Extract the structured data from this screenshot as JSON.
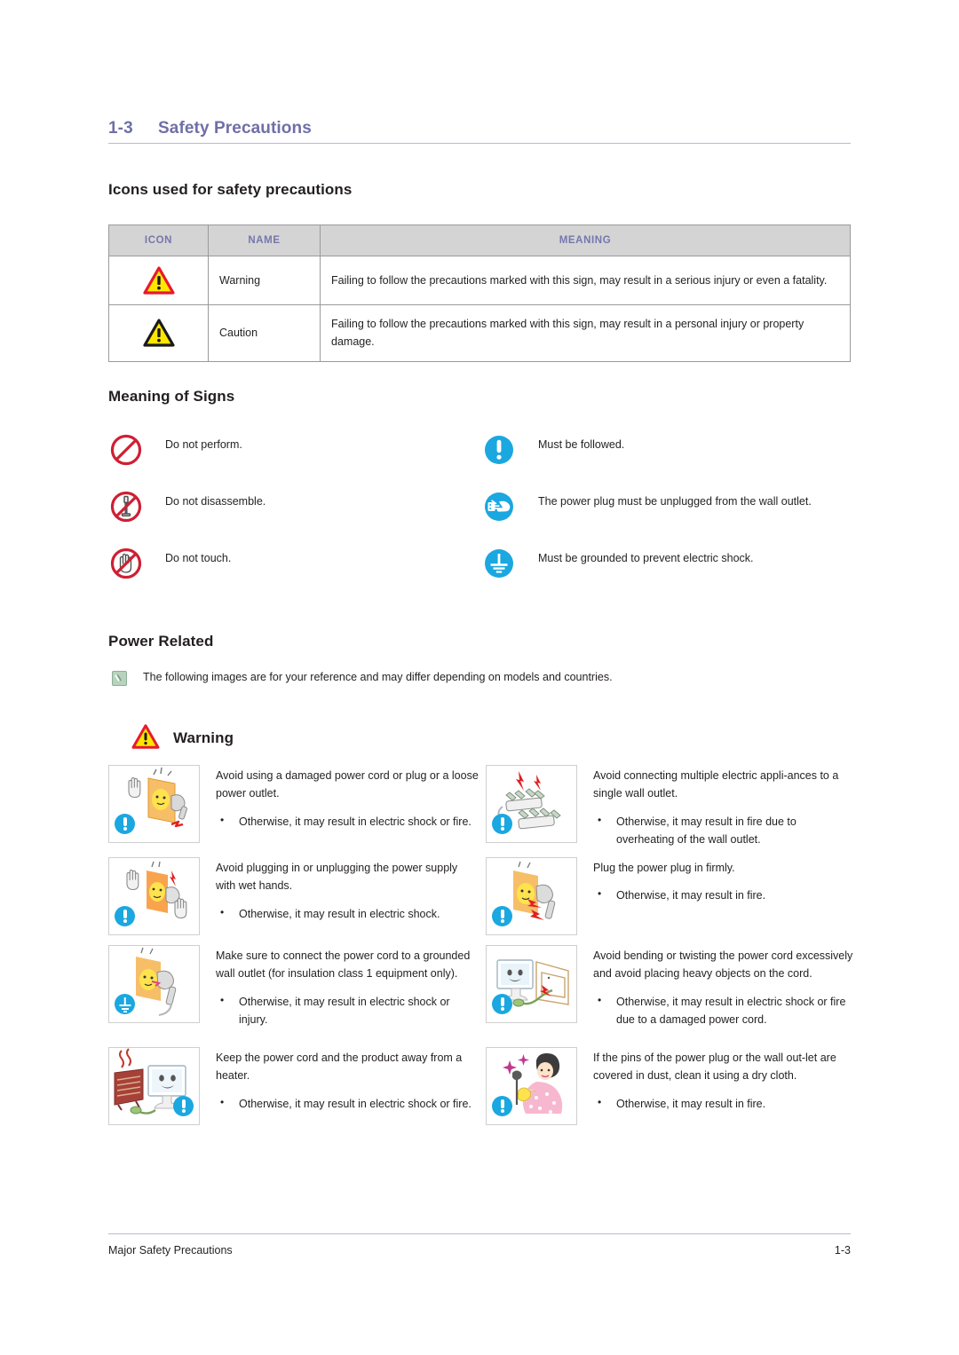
{
  "section": {
    "number": "1-3",
    "title": "Safety Precautions"
  },
  "headings": {
    "icons_used": "Icons used for safety precautions",
    "meaning_of_signs": "Meaning of Signs",
    "power_related": "Power Related"
  },
  "icons_table": {
    "headers": [
      "ICON",
      "NAME",
      "MEANING"
    ],
    "rows": [
      {
        "icon": "warning-triangle-red-icon",
        "name": "Warning",
        "meaning": "Failing to follow the precautions marked with this sign, may result in a serious injury or even a fatality."
      },
      {
        "icon": "caution-triangle-black-icon",
        "name": "Caution",
        "meaning": "Failing to follow the precautions marked with this sign, may result in a personal injury or property damage."
      }
    ]
  },
  "signs": {
    "left": [
      {
        "icon": "prohibition-circle-icon",
        "label": "Do not perform."
      },
      {
        "icon": "no-disassemble-icon",
        "label": "Do not disassemble."
      },
      {
        "icon": "no-touch-hand-icon",
        "label": "Do not touch."
      }
    ],
    "right": [
      {
        "icon": "mandatory-exclamation-icon",
        "label": "Must be followed."
      },
      {
        "icon": "unplug-power-icon",
        "label": "The power plug must be unplugged from the wall outlet."
      },
      {
        "icon": "ground-earth-icon",
        "label": "Must be grounded to prevent electric shock."
      }
    ]
  },
  "note": {
    "icon": "note-pen-icon",
    "text": "The following images are for your reference and may differ depending on models and countries."
  },
  "warning_banner": {
    "icon": "warning-triangle-red-icon",
    "label": "Warning"
  },
  "warning_items": {
    "left": [
      {
        "figure": "damaged-cord-outlet-figure",
        "badge": "mandatory-exclamation-badge",
        "badge_pos": "bottom-left",
        "heading": "Avoid using a damaged power cord or plug or a loose power outlet.",
        "bullets": [
          "Otherwise, it may result in electric shock or fire."
        ]
      },
      {
        "figure": "wet-hands-plug-figure",
        "badge": "mandatory-exclamation-badge",
        "badge_pos": "bottom-left",
        "heading": "Avoid plugging in or unplugging the power supply with wet hands.",
        "bullets": [
          "Otherwise, it may result in electric shock."
        ]
      },
      {
        "figure": "grounded-outlet-figure",
        "badge": "ground-earth-badge",
        "badge_pos": "bottom-left",
        "heading": "Make sure to connect the power cord to a grounded wall outlet (for insulation class 1 equipment only).",
        "bullets": [
          "Otherwise, it may result in electric shock or injury."
        ]
      },
      {
        "figure": "heater-near-monitor-figure",
        "badge": "mandatory-exclamation-badge",
        "badge_pos": "bottom-right",
        "heading": "Keep the power cord and the product away from a heater.",
        "bullets": [
          "Otherwise, it may result in electric shock or fire."
        ]
      }
    ],
    "right": [
      {
        "figure": "multiple-appliances-outlet-figure",
        "badge": "mandatory-exclamation-badge",
        "badge_pos": "bottom-left",
        "heading": "Avoid connecting multiple electric appli-ances to a single wall outlet.",
        "bullets": [
          "Otherwise, it may result in fire due to overheating of the wall outlet."
        ]
      },
      {
        "figure": "plug-firmly-figure",
        "badge": "mandatory-exclamation-badge",
        "badge_pos": "bottom-left",
        "heading": "Plug the power plug in firmly.",
        "bullets": [
          "Otherwise, it may result in fire."
        ]
      },
      {
        "figure": "bent-cord-monitor-figure",
        "badge": "mandatory-exclamation-badge",
        "badge_pos": "bottom-left",
        "heading": "Avoid bending or twisting the power cord excessively and avoid placing heavy objects on the cord.",
        "bullets": [
          "Otherwise, it may result in electric shock or fire due to a damaged power cord."
        ]
      },
      {
        "figure": "dusty-plug-cleaning-figure",
        "badge": "mandatory-exclamation-badge",
        "badge_pos": "bottom-left",
        "heading": "If the pins of the power plug or the wall out-let are covered in dust, clean it using a dry cloth.",
        "bullets": [
          "Otherwise, it may result in fire."
        ]
      }
    ]
  },
  "footer": {
    "left": "Major Safety Precautions",
    "right": "1-3"
  },
  "colors": {
    "title_purple": "#6f6fa8",
    "rule_purple": "#b9b9d6",
    "table_header_bg": "#d4d4d4",
    "table_header_text": "#7676ad",
    "mandatory_blue": "#1ba7e0",
    "prohibition_red": "#cf1f33",
    "warning_yellow": "#ffe600",
    "body_text": "#231f20"
  }
}
